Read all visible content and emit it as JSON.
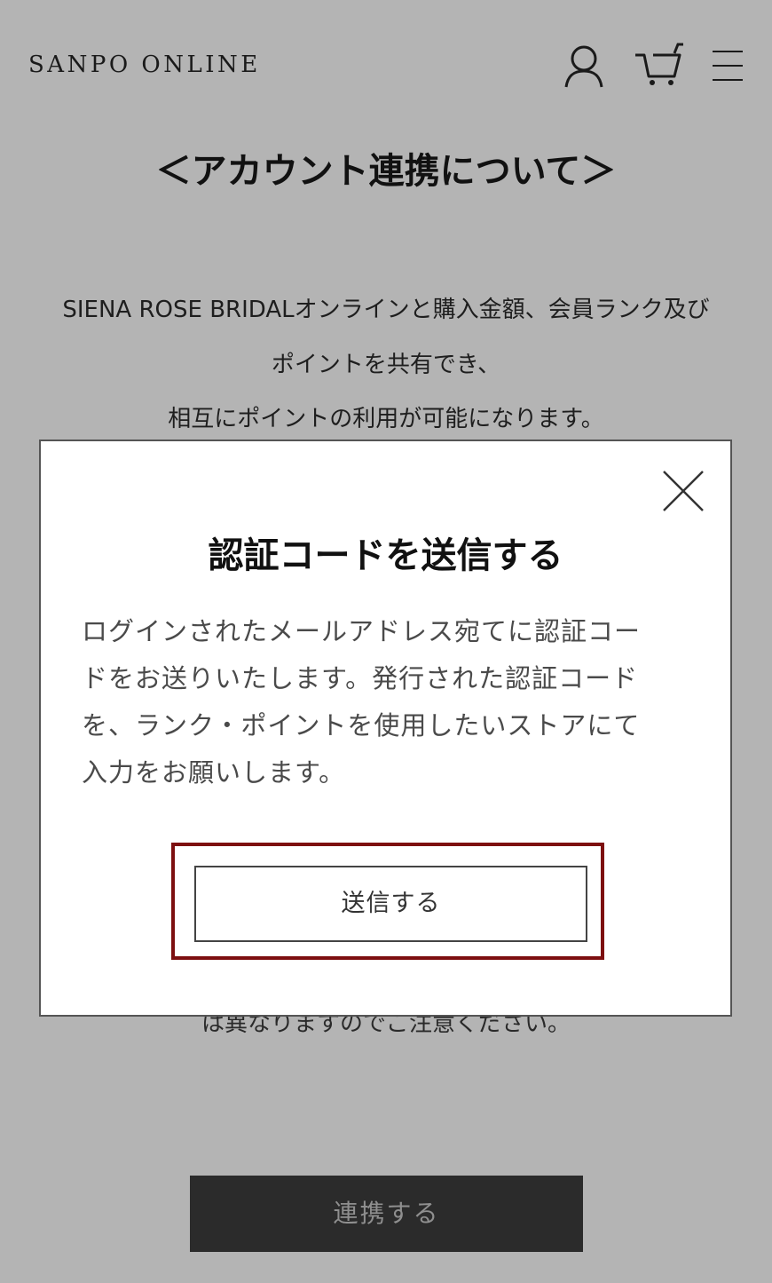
{
  "header": {
    "logo": "SANPO ONLINE",
    "icons": [
      "account-icon",
      "cart-icon",
      "menu-icon"
    ]
  },
  "page": {
    "title": "＜アカウント連携について＞",
    "description_lines": [
      "SIENA ROSE BRIDALオンラインと購入金額、会員ランク及び",
      "ポイントを共有でき、",
      "相互にポイントの利用が可能になります。"
    ],
    "partially_hidden_note": "は異なりますのでご注意ください。",
    "link_button_label": "連携する"
  },
  "modal": {
    "title": "認証コードを送信する",
    "body_lines": [
      "ログインされたメールアドレス宛てに認証コー",
      "ドをお送りいたします。発行された認証コード",
      "を、ランク・ポイントを使用したいストアにて",
      "入力をお願いします。"
    ],
    "send_button_label": "送信する",
    "close_icon": "close-icon"
  },
  "colors": {
    "overlay_background": "#b4b4b4",
    "highlight_border": "#7d0f10",
    "link_button_background": "#2b2b2b"
  }
}
